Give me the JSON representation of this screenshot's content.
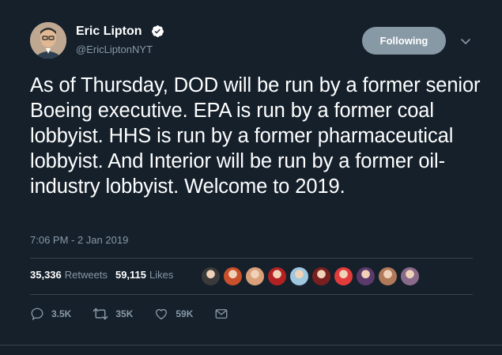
{
  "author": {
    "name": "Eric Lipton",
    "handle": "@EricLiptonNYT",
    "verified": true
  },
  "follow_button": {
    "label": "Following"
  },
  "tweet": {
    "text": "As of Thursday, DOD will be run by a former senior Boeing executive. EPA is run by a former coal lobbyist. HHS is run by a former pharmaceutical lobbyist. And Interior will be run by a former oil-industry lobbyist. Welcome to 2019.",
    "timestamp": "7:06 PM - 2 Jan 2019"
  },
  "stats": {
    "retweets_count": "35,336",
    "retweets_label": "Retweets",
    "likes_count": "59,115",
    "likes_label": "Likes"
  },
  "liker_avatars": [
    {
      "color": "#3a3a3a"
    },
    {
      "color": "#c8502a"
    },
    {
      "color": "#d9a07a"
    },
    {
      "color": "#b22222"
    },
    {
      "color": "#9fc7e0"
    },
    {
      "color": "#7a1f1f"
    },
    {
      "color": "#e23b3b"
    },
    {
      "color": "#5b3a6b"
    },
    {
      "color": "#b07a5a"
    },
    {
      "color": "#8a6a8a"
    }
  ],
  "actions": {
    "replies": "3.5K",
    "retweets": "35K",
    "likes": "59K"
  },
  "colors": {
    "background": "#15202b",
    "muted": "#8899a6",
    "divider": "#38444d",
    "button": "#8899a6"
  },
  "icons": [
    "verified-badge-icon",
    "chevron-down-icon",
    "reply-icon",
    "retweet-icon",
    "like-icon",
    "message-icon"
  ]
}
